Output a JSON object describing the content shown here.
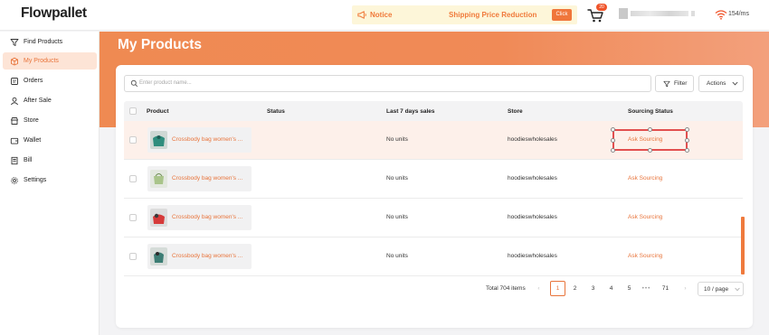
{
  "brand": {
    "logo_text": "Flowpallet",
    "accent": "#f0763b"
  },
  "topbar": {
    "notice_label": "Notice",
    "notice_message": "Shipping Price Reduction",
    "notice_button": "Click",
    "cart_badge": "20",
    "network_speed": "154/ms"
  },
  "sidebar": {
    "items": [
      {
        "label": "Find Products",
        "icon": "filter-icon"
      },
      {
        "label": "My Products",
        "icon": "box-icon",
        "active": true
      },
      {
        "label": "Orders",
        "icon": "orders-icon"
      },
      {
        "label": "After Sale",
        "icon": "after-sale-icon"
      },
      {
        "label": "Store",
        "icon": "store-icon"
      },
      {
        "label": "Wallet",
        "icon": "wallet-icon"
      },
      {
        "label": "Bill",
        "icon": "bill-icon"
      },
      {
        "label": "Settings",
        "icon": "gear-icon"
      }
    ]
  },
  "page": {
    "title": "My Products"
  },
  "toolbar": {
    "search_placeholder": "Enter product name...",
    "filter_label": "Filter",
    "actions_label": "Actions"
  },
  "table": {
    "headers": [
      "Product",
      "Status",
      "Last 7 days sales",
      "Store",
      "Sourcing Status"
    ],
    "rows": [
      {
        "product": "Crossbody bag women's ...",
        "status": "",
        "sales": "No units",
        "store": "hoodieswholesales",
        "sourcing": "Ask Sourcing",
        "highlight": true
      },
      {
        "product": "Crossbody bag women's ...",
        "status": "",
        "sales": "No units",
        "store": "hoodieswholesales",
        "sourcing": "Ask Sourcing"
      },
      {
        "product": "Crossbody bag women's ...",
        "status": "",
        "sales": "No units",
        "store": "hoodieswholesales",
        "sourcing": "Ask Sourcing"
      },
      {
        "product": "Crossbody bag women's ...",
        "status": "",
        "sales": "No units",
        "store": "hoodieswholesales",
        "sourcing": "Ask Sourcing"
      }
    ]
  },
  "pagination": {
    "total": "Total 704 items",
    "prev": "‹",
    "pages": [
      "1",
      "2",
      "3",
      "4",
      "5"
    ],
    "dots": "•••",
    "last": "71",
    "next": "›",
    "current": "1",
    "per_page": "10 / page"
  }
}
